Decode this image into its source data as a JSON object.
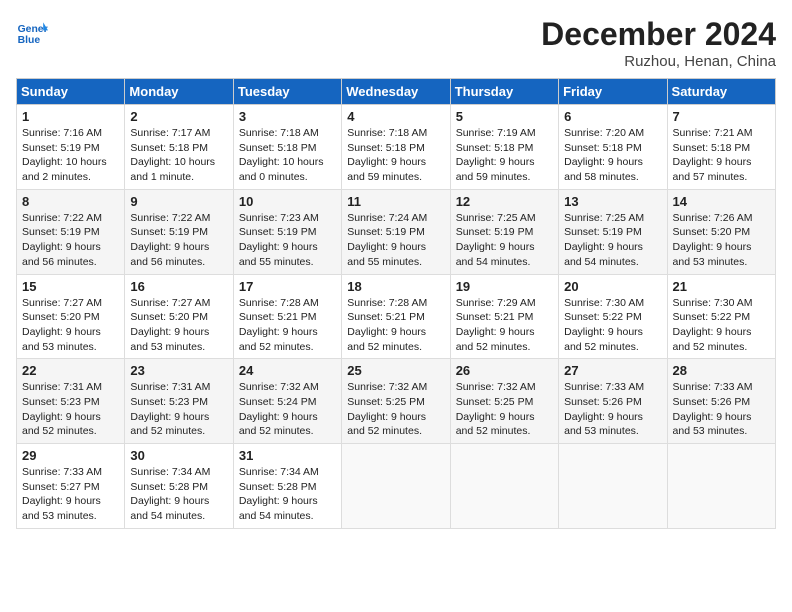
{
  "header": {
    "logo_general": "General",
    "logo_blue": "Blue",
    "month": "December 2024",
    "location": "Ruzhou, Henan, China"
  },
  "days_of_week": [
    "Sunday",
    "Monday",
    "Tuesday",
    "Wednesday",
    "Thursday",
    "Friday",
    "Saturday"
  ],
  "weeks": [
    [
      {
        "day": "1",
        "rise": "7:16 AM",
        "set": "5:19 PM",
        "daylight": "10 hours and 2 minutes."
      },
      {
        "day": "2",
        "rise": "7:17 AM",
        "set": "5:18 PM",
        "daylight": "10 hours and 1 minute."
      },
      {
        "day": "3",
        "rise": "7:18 AM",
        "set": "5:18 PM",
        "daylight": "10 hours and 0 minutes."
      },
      {
        "day": "4",
        "rise": "7:18 AM",
        "set": "5:18 PM",
        "daylight": "9 hours and 59 minutes."
      },
      {
        "day": "5",
        "rise": "7:19 AM",
        "set": "5:18 PM",
        "daylight": "9 hours and 59 minutes."
      },
      {
        "day": "6",
        "rise": "7:20 AM",
        "set": "5:18 PM",
        "daylight": "9 hours and 58 minutes."
      },
      {
        "day": "7",
        "rise": "7:21 AM",
        "set": "5:18 PM",
        "daylight": "9 hours and 57 minutes."
      }
    ],
    [
      {
        "day": "8",
        "rise": "7:22 AM",
        "set": "5:19 PM",
        "daylight": "9 hours and 56 minutes."
      },
      {
        "day": "9",
        "rise": "7:22 AM",
        "set": "5:19 PM",
        "daylight": "9 hours and 56 minutes."
      },
      {
        "day": "10",
        "rise": "7:23 AM",
        "set": "5:19 PM",
        "daylight": "9 hours and 55 minutes."
      },
      {
        "day": "11",
        "rise": "7:24 AM",
        "set": "5:19 PM",
        "daylight": "9 hours and 55 minutes."
      },
      {
        "day": "12",
        "rise": "7:25 AM",
        "set": "5:19 PM",
        "daylight": "9 hours and 54 minutes."
      },
      {
        "day": "13",
        "rise": "7:25 AM",
        "set": "5:19 PM",
        "daylight": "9 hours and 54 minutes."
      },
      {
        "day": "14",
        "rise": "7:26 AM",
        "set": "5:20 PM",
        "daylight": "9 hours and 53 minutes."
      }
    ],
    [
      {
        "day": "15",
        "rise": "7:27 AM",
        "set": "5:20 PM",
        "daylight": "9 hours and 53 minutes."
      },
      {
        "day": "16",
        "rise": "7:27 AM",
        "set": "5:20 PM",
        "daylight": "9 hours and 53 minutes."
      },
      {
        "day": "17",
        "rise": "7:28 AM",
        "set": "5:21 PM",
        "daylight": "9 hours and 52 minutes."
      },
      {
        "day": "18",
        "rise": "7:28 AM",
        "set": "5:21 PM",
        "daylight": "9 hours and 52 minutes."
      },
      {
        "day": "19",
        "rise": "7:29 AM",
        "set": "5:21 PM",
        "daylight": "9 hours and 52 minutes."
      },
      {
        "day": "20",
        "rise": "7:30 AM",
        "set": "5:22 PM",
        "daylight": "9 hours and 52 minutes."
      },
      {
        "day": "21",
        "rise": "7:30 AM",
        "set": "5:22 PM",
        "daylight": "9 hours and 52 minutes."
      }
    ],
    [
      {
        "day": "22",
        "rise": "7:31 AM",
        "set": "5:23 PM",
        "daylight": "9 hours and 52 minutes."
      },
      {
        "day": "23",
        "rise": "7:31 AM",
        "set": "5:23 PM",
        "daylight": "9 hours and 52 minutes."
      },
      {
        "day": "24",
        "rise": "7:32 AM",
        "set": "5:24 PM",
        "daylight": "9 hours and 52 minutes."
      },
      {
        "day": "25",
        "rise": "7:32 AM",
        "set": "5:25 PM",
        "daylight": "9 hours and 52 minutes."
      },
      {
        "day": "26",
        "rise": "7:32 AM",
        "set": "5:25 PM",
        "daylight": "9 hours and 52 minutes."
      },
      {
        "day": "27",
        "rise": "7:33 AM",
        "set": "5:26 PM",
        "daylight": "9 hours and 53 minutes."
      },
      {
        "day": "28",
        "rise": "7:33 AM",
        "set": "5:26 PM",
        "daylight": "9 hours and 53 minutes."
      }
    ],
    [
      {
        "day": "29",
        "rise": "7:33 AM",
        "set": "5:27 PM",
        "daylight": "9 hours and 53 minutes."
      },
      {
        "day": "30",
        "rise": "7:34 AM",
        "set": "5:28 PM",
        "daylight": "9 hours and 54 minutes."
      },
      {
        "day": "31",
        "rise": "7:34 AM",
        "set": "5:28 PM",
        "daylight": "9 hours and 54 minutes."
      },
      null,
      null,
      null,
      null
    ]
  ]
}
